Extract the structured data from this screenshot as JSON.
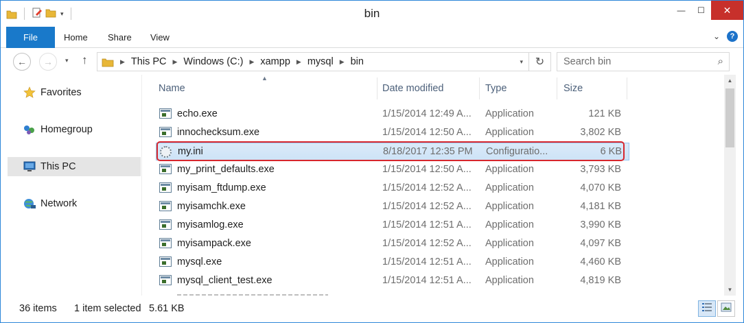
{
  "window": {
    "title": "bin",
    "controls": {
      "minimize": "—",
      "maximize": "☐",
      "close": "✕"
    }
  },
  "ribbon": {
    "tabs": [
      "File",
      "Home",
      "Share",
      "View"
    ],
    "expand_icon": "chevron-down-icon",
    "help": "?"
  },
  "nav": {
    "back": "←",
    "forward": "→",
    "up": "↑",
    "breadcrumb": [
      "This PC",
      "Windows (C:)",
      "xampp",
      "mysql",
      "bin"
    ],
    "refresh": "↻",
    "search_placeholder": "Search bin"
  },
  "navpane": {
    "items": [
      {
        "label": "Favorites",
        "icon": "star-icon"
      },
      {
        "label": "Homegroup",
        "icon": "homegroup-icon"
      },
      {
        "label": "This PC",
        "icon": "computer-icon",
        "selected": true
      },
      {
        "label": "Network",
        "icon": "network-icon"
      }
    ]
  },
  "columns": {
    "name": "Name",
    "date": "Date modified",
    "type": "Type",
    "size": "Size"
  },
  "files": [
    {
      "name": "echo.exe",
      "date": "1/15/2014 12:49 A...",
      "type": "Application",
      "size": "121 KB",
      "icon": "exe"
    },
    {
      "name": "innochecksum.exe",
      "date": "1/15/2014 12:50 A...",
      "type": "Application",
      "size": "3,802 KB",
      "icon": "exe"
    },
    {
      "name": "my.ini",
      "date": "8/18/2017 12:35 PM",
      "type": "Configuratio...",
      "size": "6 KB",
      "icon": "ini",
      "selected": true
    },
    {
      "name": "my_print_defaults.exe",
      "date": "1/15/2014 12:50 A...",
      "type": "Application",
      "size": "3,793 KB",
      "icon": "exe"
    },
    {
      "name": "myisam_ftdump.exe",
      "date": "1/15/2014 12:52 A...",
      "type": "Application",
      "size": "4,070 KB",
      "icon": "exe"
    },
    {
      "name": "myisamchk.exe",
      "date": "1/15/2014 12:52 A...",
      "type": "Application",
      "size": "4,181 KB",
      "icon": "exe"
    },
    {
      "name": "myisamlog.exe",
      "date": "1/15/2014 12:51 A...",
      "type": "Application",
      "size": "3,990 KB",
      "icon": "exe"
    },
    {
      "name": "myisampack.exe",
      "date": "1/15/2014 12:52 A...",
      "type": "Application",
      "size": "4,097 KB",
      "icon": "exe"
    },
    {
      "name": "mysql.exe",
      "date": "1/15/2014 12:51 A...",
      "type": "Application",
      "size": "4,460 KB",
      "icon": "exe"
    },
    {
      "name": "mysql_client_test.exe",
      "date": "1/15/2014 12:51 A...",
      "type": "Application",
      "size": "4,819 KB",
      "icon": "exe"
    }
  ],
  "status": {
    "items": "36 items",
    "selected": "1 item selected",
    "size": "5.61 KB"
  },
  "colors": {
    "accent": "#1979ca",
    "close": "#c7302b",
    "highlight_border": "#d8262c",
    "selection": "#cde3f7"
  }
}
